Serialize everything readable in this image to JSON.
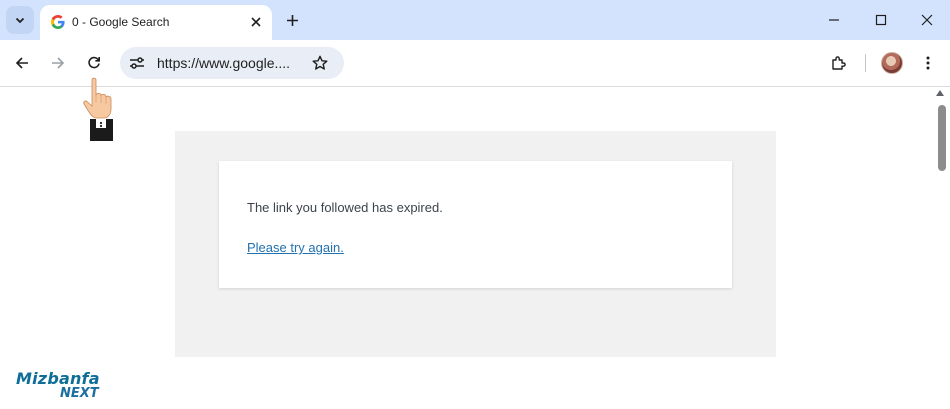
{
  "tab": {
    "title": "0 - Google Search",
    "favicon": "google-g-icon"
  },
  "omnibox": {
    "url": "https://www.google...."
  },
  "page": {
    "message": "The link you followed has expired.",
    "retry_link": "Please try again."
  },
  "watermark": {
    "brand": "Mizbanfa",
    "sub": "NEXT"
  },
  "colors": {
    "titlebar": "#d3e3fd",
    "link": "#2271b1",
    "panel": "#f1f1f1"
  }
}
